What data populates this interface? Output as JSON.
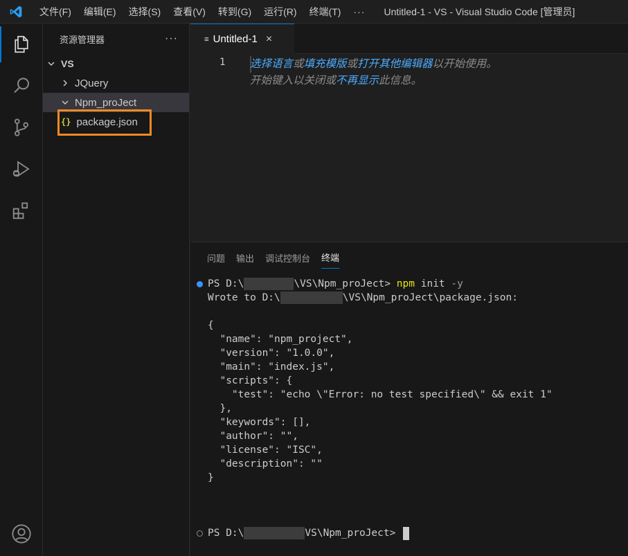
{
  "titlebar": {
    "menus": [
      "文件(F)",
      "编辑(E)",
      "选择(S)",
      "查看(V)",
      "转到(G)",
      "运行(R)",
      "终端(T)"
    ],
    "more": "···",
    "window_title": "Untitled-1 - VS - Visual Studio Code [管理员]"
  },
  "activitybar": {
    "icons": [
      "explorer-icon",
      "search-icon",
      "source-control-icon",
      "run-debug-icon",
      "extensions-icon",
      "account-icon"
    ]
  },
  "sidebar": {
    "title": "资源管理器",
    "more": "···",
    "root": "VS",
    "items": [
      {
        "label": "JQuery",
        "expanded": false
      },
      {
        "label": "Npm_proJect",
        "expanded": true
      }
    ],
    "file": "package.json",
    "file_icon": "{}"
  },
  "editor": {
    "tab_label": "Untitled-1",
    "tab_close": "×",
    "line_number": "1",
    "hint_line1": {
      "link1": "选择语言",
      "text1": "或",
      "link2": "填充模版",
      "text2": "或",
      "link3": "打开其他编辑器",
      "text3": "以开始使用。"
    },
    "hint_line2": {
      "text1": "开始键入以关闭或",
      "link1": "不再显示",
      "text2": "此信息。"
    }
  },
  "panel": {
    "tabs": [
      "问题",
      "输出",
      "调试控制台",
      "终端"
    ],
    "active_tab": "终端"
  },
  "terminal": {
    "prompt1_prefix": "PS D:\\",
    "prompt1_suffix": "\\VS\\Npm_proJect> ",
    "command": "npm",
    "command_args": " init ",
    "command_flag": "-y",
    "wrote_prefix": "Wrote to D:\\",
    "wrote_suffix": "\\VS\\Npm_proJect\\package.json:",
    "json_lines": [
      "{",
      "  \"name\": \"npm_project\",",
      "  \"version\": \"1.0.0\",",
      "  \"main\": \"index.js\",",
      "  \"scripts\": {",
      "    \"test\": \"echo \\\"Error: no test specified\\\" && exit 1\"",
      "  },",
      "  \"keywords\": [],",
      "  \"author\": \"\",",
      "  \"license\": \"ISC\",",
      "  \"description\": \"\"",
      "}"
    ],
    "prompt2_prefix": "PS D:\\",
    "prompt2_suffix": "VS\\Npm_proJect> "
  },
  "colors": {
    "accent": "#0078d4",
    "highlight_box": "#f08a24",
    "link": "#4daafc",
    "command": "#e5e510"
  }
}
